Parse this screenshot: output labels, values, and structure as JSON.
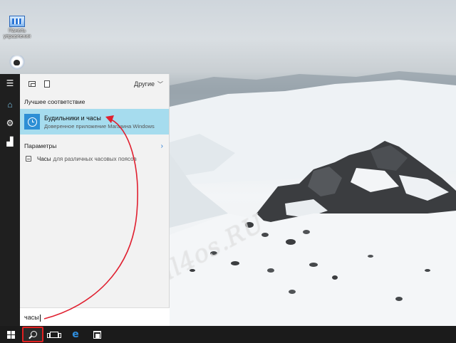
{
  "desktop": {
    "icons": [
      {
        "label": "Панель управления",
        "icon": "control-panel-icon"
      },
      {
        "label": "",
        "icon": "gadget-icon"
      }
    ],
    "watermark": "All4os.RU"
  },
  "rail": {
    "items": [
      {
        "icon": "hamburger-menu-icon"
      },
      {
        "icon": "home-icon"
      },
      {
        "icon": "settings-gear-icon"
      },
      {
        "icon": "feedback-icon"
      }
    ]
  },
  "search_panel": {
    "top_bar": {
      "filters": [
        "apps-filter-icon",
        "documents-filter-icon"
      ],
      "others_label": "Другие"
    },
    "best_match_heading": "Лучшее соответствие",
    "best_match": {
      "title": "Будильники и часы",
      "subtitle": "Доверенное приложение Магазина Windows",
      "icon": "alarm-clock-icon",
      "highlight_color": "#a6dcee"
    },
    "settings_heading": "Параметры",
    "settings_results": [
      {
        "bold": "Часы",
        "rest": "для различных часовых поясов"
      }
    ],
    "query": "часы"
  },
  "taskbar": {
    "items": [
      "start-button",
      "search-button",
      "task-view-button",
      "edge-button",
      "store-button"
    ],
    "highlight_color": "#e02020"
  },
  "annotation": {
    "arrow_color": "#e02030"
  }
}
